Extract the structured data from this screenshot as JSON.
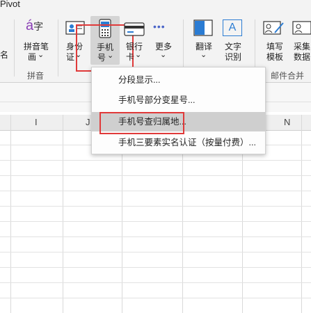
{
  "window": {
    "title_fragment": "Pivot"
  },
  "ribbon": {
    "left_cut_label": "名",
    "buttons": {
      "pinyin": {
        "glyph": "á",
        "glyph2": "字",
        "line1": "拼音笔",
        "line2": "画"
      },
      "idcard": {
        "line1": "身份",
        "line2": "证"
      },
      "phone": {
        "line1": "手机",
        "line2": "号"
      },
      "bankcard": {
        "line1": "银行",
        "line2": "卡"
      },
      "more": {
        "dots": "•••",
        "line1": "更多"
      },
      "translate": {
        "line1": "翻译"
      },
      "ocr": {
        "glyph": "A",
        "line1": "文字",
        "line2": "识别"
      },
      "fill_template": {
        "line1": "填写",
        "line2": "模板"
      },
      "collect_data": {
        "line1": "采集",
        "line2": "数据"
      }
    },
    "dropdown_arrow": "⌄",
    "groups": {
      "pinyin": "拼音",
      "mail_merge": "邮件合并"
    }
  },
  "sheet": {
    "columns": [
      "I",
      "J",
      "N"
    ]
  },
  "phone_menu": {
    "items": [
      "分段显示...",
      "手机号部分变星号...",
      "手机号查归属地...",
      "手机三要素实名认证（按量付费）..."
    ],
    "hovered_index": 2
  },
  "colors": {
    "highlight_box": "#e03a3a",
    "ribbon_bg": "#f3f3f3",
    "accent_blue": "#2b7cd3"
  }
}
